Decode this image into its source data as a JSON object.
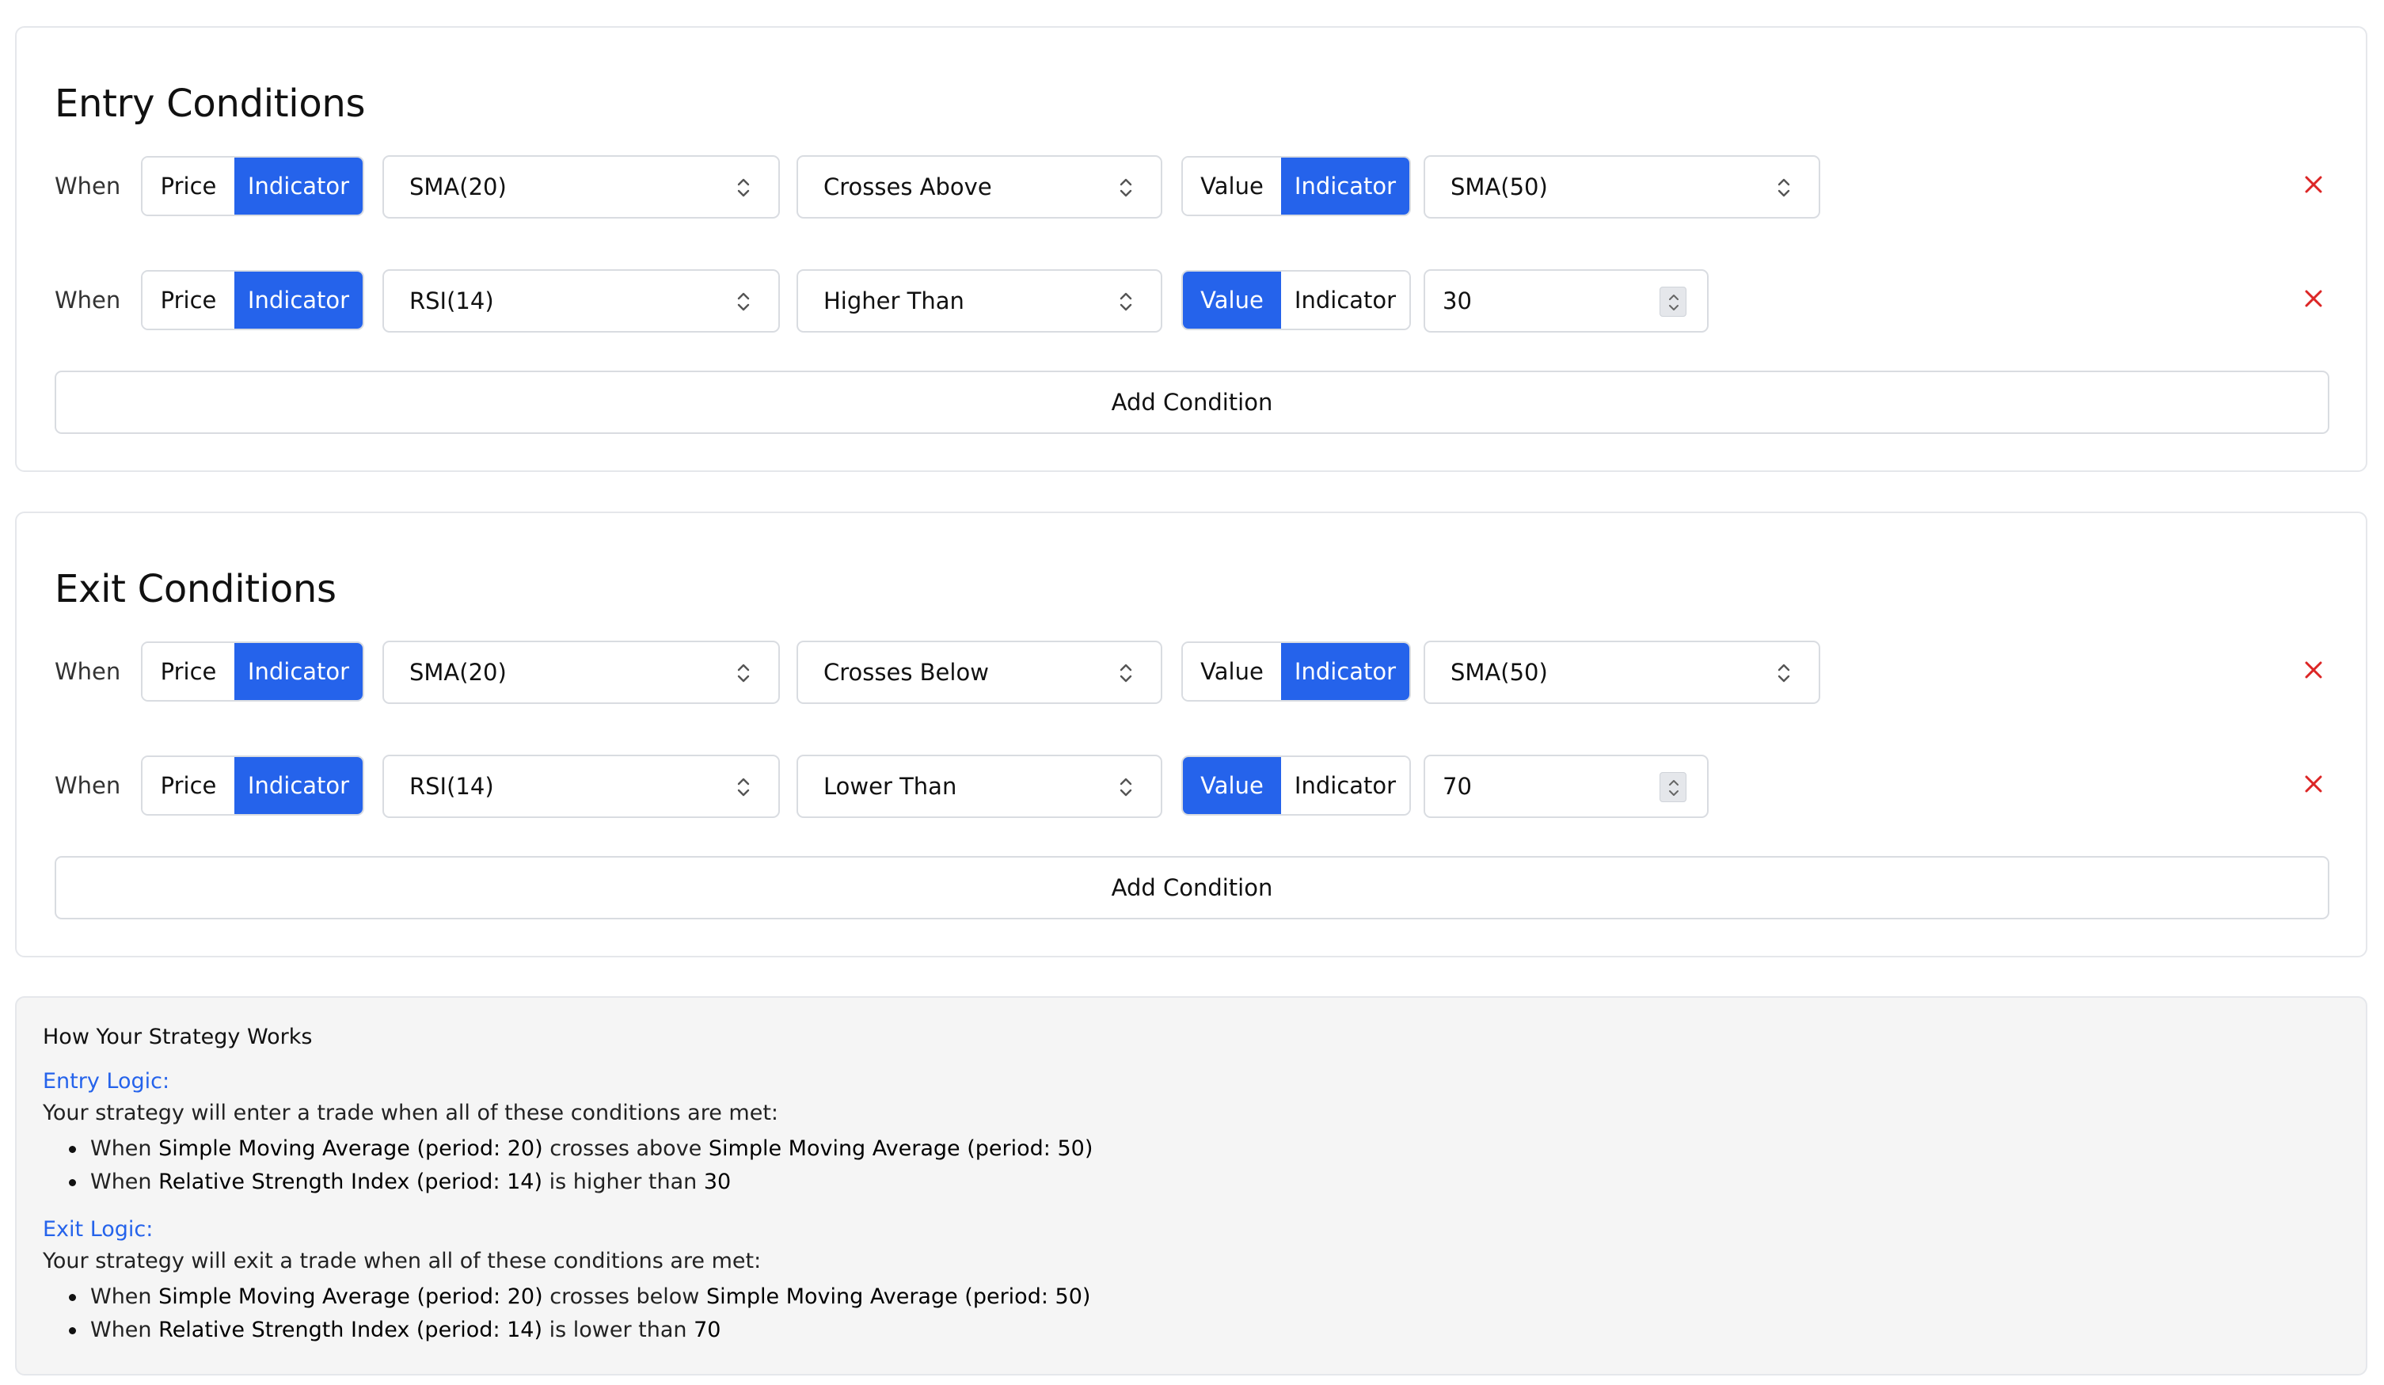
{
  "entry": {
    "title": "Entry Conditions",
    "add_label": "Add Condition",
    "conditions": [
      {
        "when": "When",
        "left_toggle": [
          "Price",
          "Indicator"
        ],
        "left_value": "SMA(20)",
        "operator": "Crosses Above",
        "right_toggle": [
          "Value",
          "Indicator"
        ],
        "right_value": "SMA(50)"
      },
      {
        "when": "When",
        "left_toggle": [
          "Price",
          "Indicator"
        ],
        "left_value": "RSI(14)",
        "operator": "Higher Than",
        "right_toggle": [
          "Value",
          "Indicator"
        ],
        "right_value": "30"
      }
    ]
  },
  "exit": {
    "title": "Exit Conditions",
    "add_label": "Add Condition",
    "conditions": [
      {
        "when": "When",
        "left_toggle": [
          "Price",
          "Indicator"
        ],
        "left_value": "SMA(20)",
        "operator": "Crosses Below",
        "right_toggle": [
          "Value",
          "Indicator"
        ],
        "right_value": "SMA(50)"
      },
      {
        "when": "When",
        "left_toggle": [
          "Price",
          "Indicator"
        ],
        "left_value": "RSI(14)",
        "operator": "Lower Than",
        "right_toggle": [
          "Value",
          "Indicator"
        ],
        "right_value": "70"
      }
    ]
  },
  "summary": {
    "title": "How Your Strategy Works",
    "entry_heading": "Entry Logic:",
    "entry_desc": "Your strategy will enter a trade when all of these conditions are met:",
    "entry_items": [
      {
        "w": "When",
        "a": "Simple Moving Average (period: 20)",
        "op": "crosses above",
        "b": "Simple Moving Average (period: 50)"
      },
      {
        "w": "When",
        "a": "Relative Strength Index (period: 14)",
        "op": "is higher than",
        "b": "30"
      }
    ],
    "exit_heading": "Exit Logic:",
    "exit_desc": "Your strategy will exit a trade when all of these conditions are met:",
    "exit_items": [
      {
        "w": "When",
        "a": "Simple Moving Average (period: 20)",
        "op": "crosses below",
        "b": "Simple Moving Average (period: 50)"
      },
      {
        "w": "When",
        "a": "Relative Strength Index (period: 14)",
        "op": "is lower than",
        "b": "70"
      }
    ]
  },
  "colors": {
    "accent": "#2563eb",
    "remove": "#dc2626",
    "border": "#d9dce1",
    "summary_bg": "#f5f5f5"
  },
  "icons": {
    "select_chevron": "chevron-up-down-icon",
    "remove": "close-icon",
    "number_spinner": "spinner-icon"
  }
}
